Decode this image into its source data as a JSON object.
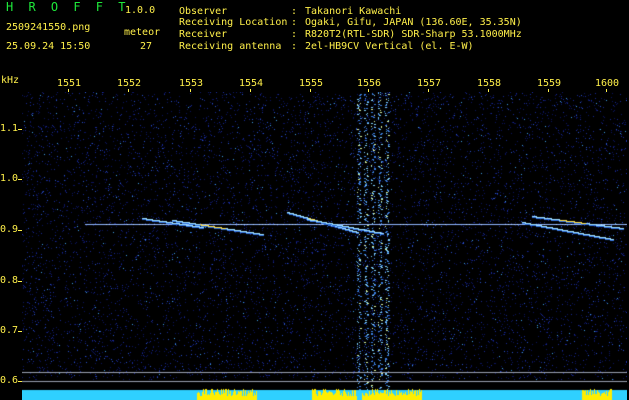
{
  "header": {
    "title": "H R O F F T",
    "version": "1.0.0",
    "filename": "2509241550.png",
    "datetime": "25.09.24 15:50",
    "meteor_label": "meteor",
    "meteor_count": "27"
  },
  "info": {
    "observer_key": "Observer",
    "observer_val": "Takanori Kawachi",
    "location_key": "Receiving Location",
    "location_val": "Ogaki, Gifu, JAPAN (136.60E, 35.35N)",
    "receiver_key": "Receiver",
    "receiver_val": "R820T2(RTL-SDR) SDR-Sharp 53.1000MHz",
    "antenna_key": "Receiving antenna",
    "antenna_val": "2el-HB9CV Vertical (el. E-W)",
    "separator": ":"
  },
  "axis": {
    "y_unit": "kHz",
    "y_ticks": [
      "1.1",
      "1.0",
      "0.9",
      "0.8",
      "0.7",
      "0.6"
    ],
    "x_ticks": [
      "1551",
      "1552",
      "1553",
      "1554",
      "1555",
      "1556",
      "1557",
      "1558",
      "1559",
      "1600"
    ]
  },
  "colors": {
    "text_primary": "#fff04a",
    "title_green": "#1ee83a",
    "background": "#000000",
    "spectrum_noise": "#1a2a9a",
    "carrier_line": "#8fb6ff",
    "signal_hot": "#ffe04a",
    "baseline_bar": "#2fd0ff",
    "baseline_peak": "#ffee00"
  }
}
